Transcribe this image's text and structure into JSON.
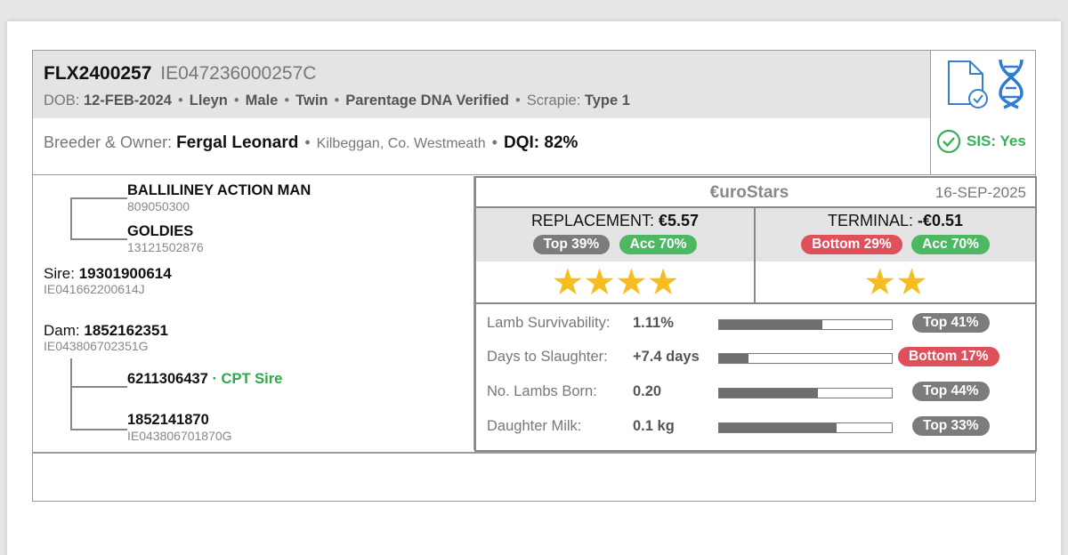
{
  "animal": {
    "id": "FLX2400257",
    "tag": "IE047236000257C",
    "dob_label": "DOB:",
    "dob": "12-FEB-2024",
    "breed": "Lleyn",
    "sex": "Male",
    "birth_type": "Twin",
    "dna": "Parentage DNA Verified",
    "scrapie_label": "Scrapie:",
    "scrapie": "Type 1"
  },
  "owner": {
    "label": "Breeder & Owner:",
    "name": "Fergal Leonard",
    "location": "Kilbeggan, Co. Westmeath",
    "dqi_label": "DQI:",
    "dqi": "82%"
  },
  "side": {
    "sis": "SIS: Yes",
    "icons": [
      "document-check-icon",
      "dna-icon",
      "check-circle-icon"
    ]
  },
  "pedigree": {
    "sire_grandsire_name": "BALLILINEY ACTION MAN",
    "sire_grandsire_tag": "809050300",
    "sire_granddam_name": "GOLDIES",
    "sire_granddam_tag": "13121502876",
    "sire_label": "Sire:",
    "sire_id": "19301900614",
    "sire_tag": "IE041662200614J",
    "dam_label": "Dam:",
    "dam_id": "1852162351",
    "dam_tag": "IE043806702351G",
    "dam_grandsire_name": "6211306437",
    "dam_grandsire_note": "· CPT Sire",
    "dam_granddam_name": "1852141870",
    "dam_granddam_tag": "IE043806701870G"
  },
  "eurostars": {
    "brand": "€uroStars",
    "date": "16-SEP-2025",
    "replacement": {
      "label": "REPLACEMENT:",
      "value": "€5.57",
      "rank": "Top 39%",
      "accuracy": "Acc 70%",
      "stars": 4,
      "rank_color": "#7c7c7c"
    },
    "terminal": {
      "label": "TERMINAL:",
      "value": "-€0.51",
      "rank": "Bottom 29%",
      "accuracy": "Acc 70%",
      "stars": 2,
      "rank_color": "#e0505a"
    },
    "traits": [
      {
        "label": "Lamb Survivability:",
        "value": "1.11%",
        "fill": 0.6,
        "rank": "Top 41%",
        "color": "#7c7c7c"
      },
      {
        "label": "Days to Slaughter:",
        "value": "+7.4 days",
        "fill": 0.17,
        "rank": "Bottom 17%",
        "color": "#e0505a"
      },
      {
        "label": "No. Lambs Born:",
        "value": "0.20",
        "fill": 0.57,
        "rank": "Top 44%",
        "color": "#7c7c7c"
      },
      {
        "label": "Daughter Milk:",
        "value": "0.1 kg",
        "fill": 0.68,
        "rank": "Top 33%",
        "color": "#7c7c7c"
      }
    ]
  }
}
